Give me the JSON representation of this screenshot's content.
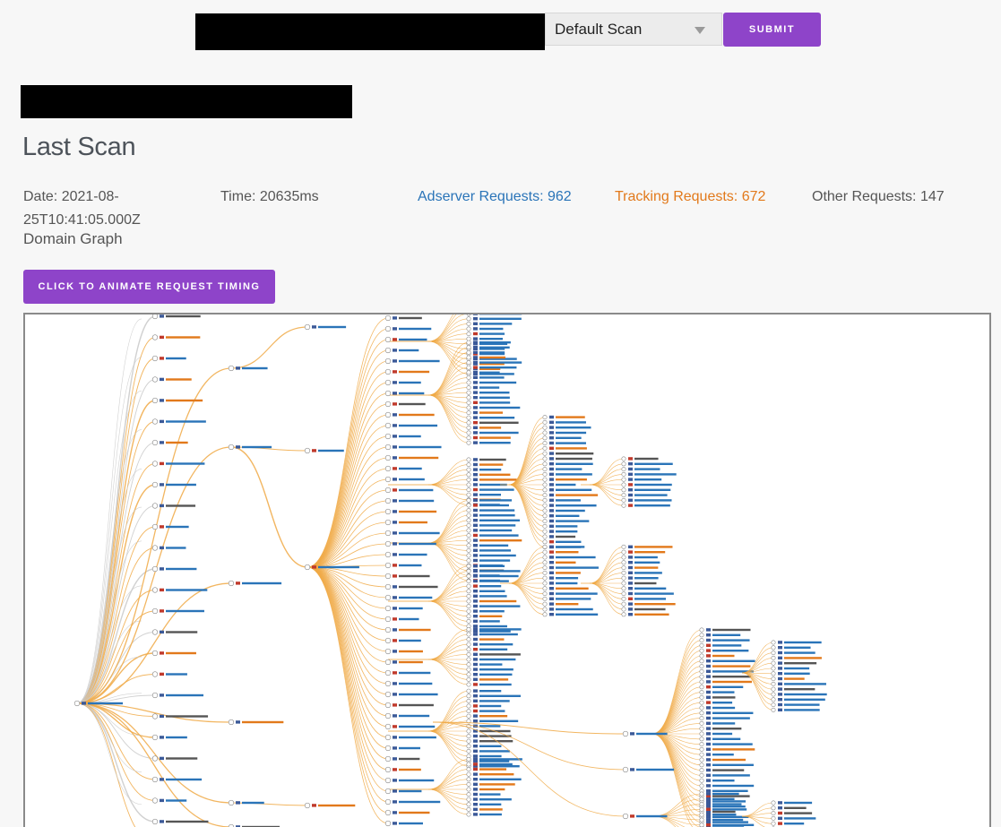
{
  "header": {
    "scan_type_selected": "Default Scan",
    "submit_label": "SUBMIT"
  },
  "scan": {
    "title": "Last Scan",
    "date_label": "Date: 2021-08-25T10:41:05.000Z",
    "time_label": "Time: 20635ms",
    "adserver_label": "Adserver Requests: 962",
    "tracking_label": "Tracking Requests: 672",
    "other_label": "Other Requests: 147",
    "graph_label": "Domain Graph",
    "animate_label": "CLICK TO ANIMATE REQUEST TIMING"
  },
  "colors": {
    "accent": "#8e44c9",
    "adserver": "#2a74b8",
    "tracking": "#e2791b",
    "edge": "#f0a945"
  }
}
